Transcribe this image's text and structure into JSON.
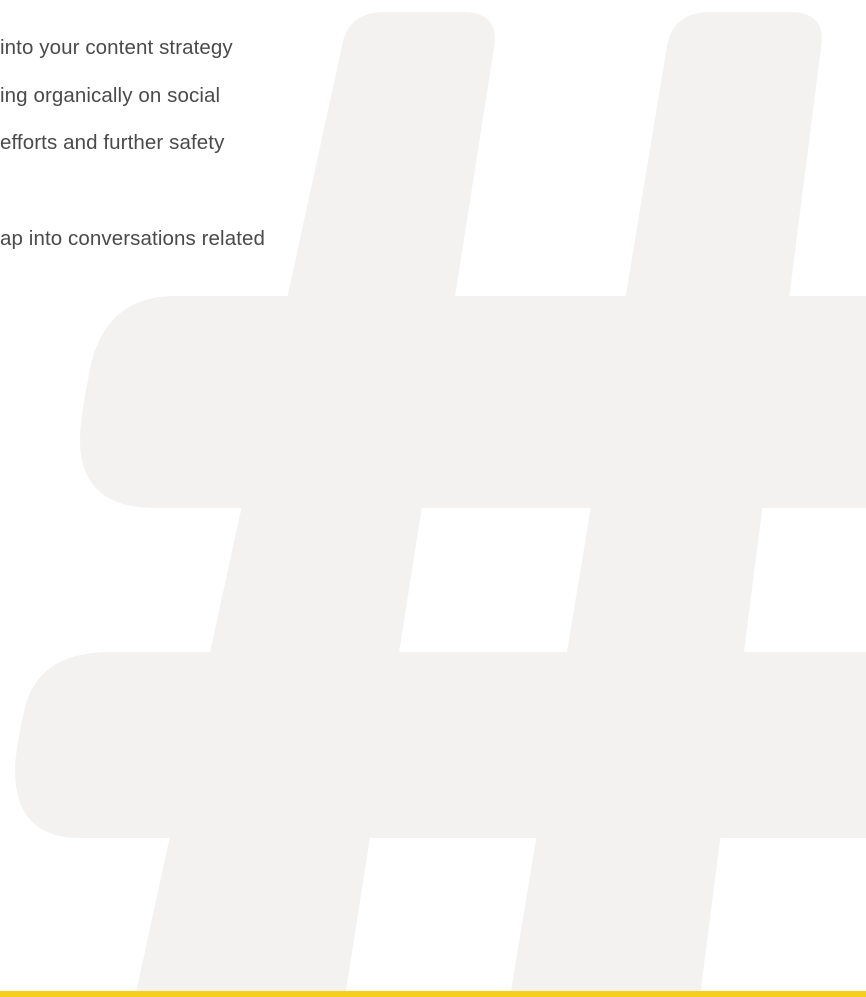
{
  "content": {
    "lines": [
      "into your content strategy",
      "ing organically on social",
      "efforts and further safety",
      "ap into conversations related"
    ]
  },
  "decor": {
    "symbol_name": "hashtag-icon",
    "symbol_color": "#f3f2f1",
    "accent_bar_color": "#f5cf1c"
  }
}
